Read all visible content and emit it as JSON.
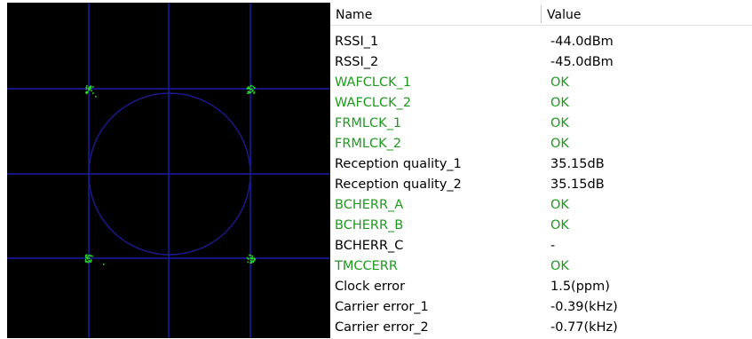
{
  "colors": {
    "scope_background": "#000000",
    "scope_grid": "#1a1aa8",
    "scope_circle": "#1a1a8a",
    "constellation_points": "#2ed42e",
    "ok_text": "#1e9a1e",
    "normal_text": "#000000"
  },
  "table": {
    "columns": {
      "name": "Name",
      "value": "Value"
    },
    "rows": [
      {
        "name": "RSSI_1",
        "value": "-44.0dBm",
        "status": "normal"
      },
      {
        "name": "RSSI_2",
        "value": "-45.0dBm",
        "status": "normal"
      },
      {
        "name": "WAFCLCK_1",
        "value": "OK",
        "status": "ok"
      },
      {
        "name": "WAFCLCK_2",
        "value": "OK",
        "status": "ok"
      },
      {
        "name": "FRMLCK_1",
        "value": "OK",
        "status": "ok"
      },
      {
        "name": "FRMLCK_2",
        "value": "OK",
        "status": "ok"
      },
      {
        "name": "Reception quality_1",
        "value": "35.15dB",
        "status": "normal"
      },
      {
        "name": "Reception quality_2",
        "value": "35.15dB",
        "status": "normal"
      },
      {
        "name": "BCHERR_A",
        "value": "OK",
        "status": "ok"
      },
      {
        "name": "BCHERR_B",
        "value": "OK",
        "status": "ok"
      },
      {
        "name": "BCHERR_C",
        "value": "-",
        "status": "normal"
      },
      {
        "name": "TMCCERR",
        "value": "OK",
        "status": "ok"
      },
      {
        "name": "Clock error",
        "value": "1.5(ppm)",
        "status": "normal"
      },
      {
        "name": "Carrier error_1",
        "value": "-0.39(kHz)",
        "status": "normal"
      },
      {
        "name": "Carrier error_2",
        "value": "-0.77(kHz)",
        "status": "normal"
      }
    ]
  }
}
